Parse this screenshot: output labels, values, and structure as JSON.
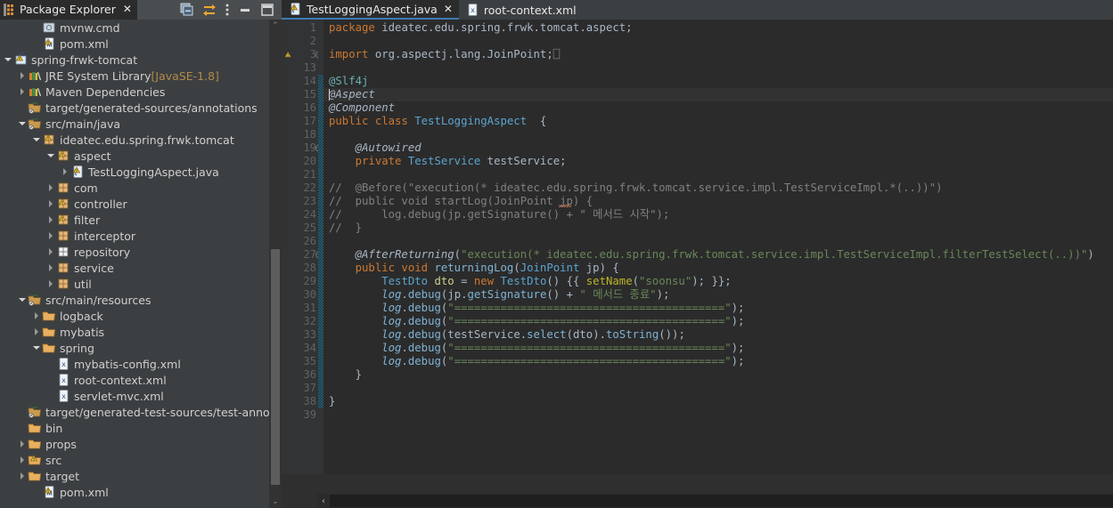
{
  "explorer": {
    "tab": {
      "title": "Package Explorer",
      "close_label": "✕",
      "icon": "package-explorer-icon"
    },
    "toolbar": [
      {
        "name": "collapse-all-icon",
        "tooltip": "Collapse All"
      },
      {
        "name": "link-with-editor-icon",
        "tooltip": "Link with Editor"
      },
      {
        "name": "view-menu-icon",
        "tooltip": "View Menu"
      },
      {
        "name": "minimize-icon",
        "tooltip": "Minimize"
      },
      {
        "name": "maximize-icon",
        "tooltip": "Maximize"
      }
    ],
    "tree": [
      {
        "label": "mvnw.cmd",
        "indent": 2,
        "twisty": "none",
        "icon": "cmd-file-icon"
      },
      {
        "label": "pom.xml",
        "indent": 2,
        "twisty": "none",
        "icon": "maven-pom-icon"
      },
      {
        "label": "spring-frwk-tomcat",
        "indent": 0,
        "twisty": "down",
        "icon": "java-project-icon"
      },
      {
        "label": "JRE System Library",
        "suffix": " [JavaSE-1.8]",
        "indent": 1,
        "twisty": "right",
        "icon": "library-icon"
      },
      {
        "label": "Maven Dependencies",
        "indent": 1,
        "twisty": "right",
        "icon": "library-icon"
      },
      {
        "label": "target/generated-sources/annotations",
        "indent": 1,
        "twisty": "none",
        "icon": "source-folder-icon"
      },
      {
        "label": "src/main/java",
        "indent": 1,
        "twisty": "down",
        "icon": "source-folder-icon"
      },
      {
        "label": "ideatec.edu.spring.frwk.tomcat",
        "indent": 2,
        "twisty": "down",
        "icon": "package-icon"
      },
      {
        "label": "aspect",
        "indent": 3,
        "twisty": "down",
        "icon": "package-icon"
      },
      {
        "label": "TestLoggingAspect.java",
        "indent": 4,
        "twisty": "right",
        "icon": "java-file-icon"
      },
      {
        "label": "com",
        "indent": 3,
        "twisty": "right",
        "icon": "package-plain-icon"
      },
      {
        "label": "controller",
        "indent": 3,
        "twisty": "right",
        "icon": "package-icon"
      },
      {
        "label": "filter",
        "indent": 3,
        "twisty": "right",
        "icon": "package-icon"
      },
      {
        "label": "interceptor",
        "indent": 3,
        "twisty": "right",
        "icon": "package-plain-icon"
      },
      {
        "label": "repository",
        "indent": 3,
        "twisty": "right",
        "icon": "package-empty-icon"
      },
      {
        "label": "service",
        "indent": 3,
        "twisty": "right",
        "icon": "package-plain-icon"
      },
      {
        "label": "util",
        "indent": 3,
        "twisty": "right",
        "icon": "package-plain-icon"
      },
      {
        "label": "src/main/resources",
        "indent": 1,
        "twisty": "down",
        "icon": "source-folder-icon"
      },
      {
        "label": "logback",
        "indent": 2,
        "twisty": "right",
        "icon": "folder-icon"
      },
      {
        "label": "mybatis",
        "indent": 2,
        "twisty": "right",
        "icon": "folder-icon"
      },
      {
        "label": "spring",
        "indent": 2,
        "twisty": "down",
        "icon": "folder-icon"
      },
      {
        "label": "mybatis-config.xml",
        "indent": 3,
        "twisty": "none",
        "icon": "xml-file-icon"
      },
      {
        "label": "root-context.xml",
        "indent": 3,
        "twisty": "none",
        "icon": "xml-file-icon"
      },
      {
        "label": "servlet-mvc.xml",
        "indent": 3,
        "twisty": "none",
        "icon": "xml-file-icon"
      },
      {
        "label": "target/generated-test-sources/test-annotation",
        "indent": 1,
        "twisty": "none",
        "icon": "source-folder-icon"
      },
      {
        "label": "bin",
        "indent": 1,
        "twisty": "none",
        "icon": "folder-icon"
      },
      {
        "label": "props",
        "indent": 1,
        "twisty": "right",
        "icon": "folder-icon"
      },
      {
        "label": "src",
        "indent": 1,
        "twisty": "right",
        "icon": "folder-warn-icon"
      },
      {
        "label": "target",
        "indent": 1,
        "twisty": "right",
        "icon": "folder-icon"
      },
      {
        "label": "pom.xml",
        "indent": 2,
        "twisty": "none",
        "icon": "maven-pom-icon"
      }
    ],
    "scrollbar": {
      "up_arrow": "⌃",
      "down_arrow": "⌄"
    }
  },
  "editor": {
    "tabs": [
      {
        "title": "TestLoggingAspect.java",
        "icon": "java-file-warn-icon",
        "active": true,
        "close_label": "✕"
      },
      {
        "title": "root-context.xml",
        "icon": "xml-file-icon",
        "active": false,
        "close_label": ""
      }
    ],
    "first_line": 1,
    "line_numbers": [
      1,
      2,
      3,
      13,
      14,
      15,
      16,
      17,
      18,
      19,
      20,
      21,
      22,
      23,
      24,
      25,
      26,
      27,
      28,
      29,
      30,
      31,
      32,
      33,
      34,
      35,
      36,
      37,
      38,
      39
    ],
    "current_line": 15,
    "change_bar_from_line": 14,
    "change_bar_to_line": 38,
    "hscroll_left_arrow": "‹",
    "lines": [
      {
        "n": 1,
        "tokens": [
          {
            "t": "package ",
            "c": "kw"
          },
          {
            "t": "ideatec.edu.spring.frwk.tomcat.aspect;",
            "c": "def"
          }
        ]
      },
      {
        "n": 2,
        "tokens": []
      },
      {
        "n": 3,
        "tokens": [
          {
            "t": "import ",
            "c": "kw"
          },
          {
            "t": "org.aspectj.lang.JoinPoint;",
            "c": "def"
          },
          {
            "t": "⎕",
            "c": "cmt"
          }
        ]
      },
      {
        "n": 13,
        "tokens": []
      },
      {
        "n": 14,
        "tokens": [
          {
            "t": "@Slf4j",
            "c": "anT"
          }
        ]
      },
      {
        "n": 15,
        "tokens": [
          {
            "t": "@Aspect",
            "c": "anW"
          }
        ]
      },
      {
        "n": 16,
        "tokens": [
          {
            "t": "@Component",
            "c": "anW"
          }
        ]
      },
      {
        "n": 17,
        "tokens": [
          {
            "t": "public class ",
            "c": "kw"
          },
          {
            "t": "TestLoggingAspect",
            "c": "typ"
          },
          {
            "t": "  {",
            "c": "def"
          }
        ]
      },
      {
        "n": 18,
        "tokens": []
      },
      {
        "n": 19,
        "tokens": [
          {
            "t": "    @Autowired",
            "c": "anW"
          }
        ]
      },
      {
        "n": 20,
        "tokens": [
          {
            "t": "    private ",
            "c": "kw"
          },
          {
            "t": "TestService",
            "c": "typ"
          },
          {
            "t": " testService;",
            "c": "def"
          }
        ]
      },
      {
        "n": 21,
        "tokens": []
      },
      {
        "n": 22,
        "tokens": [
          {
            "t": "//  @Before(\"execution(* ideatec.edu.spring.frwk.tomcat.service.impl.TestServiceImpl.*(..))\")",
            "c": "cmt"
          }
        ]
      },
      {
        "n": 23,
        "tokens": [
          {
            "t": "//  public void startLog(JoinPoint jp) {",
            "c": "cmt"
          }
        ]
      },
      {
        "n": 24,
        "tokens": [
          {
            "t": "//      log.debug(jp.getSignature() + \" 메서드 시작\");",
            "c": "cmt"
          }
        ]
      },
      {
        "n": 25,
        "tokens": [
          {
            "t": "//  }",
            "c": "cmt"
          }
        ]
      },
      {
        "n": 26,
        "tokens": []
      },
      {
        "n": 27,
        "tokens": [
          {
            "t": "    @AfterReturning",
            "c": "anW"
          },
          {
            "t": "(",
            "c": "def"
          },
          {
            "t": "\"execution(* ideatec.edu.spring.frwk.tomcat.service.impl.TestServiceImpl.filterTestSelect(..))\"",
            "c": "str"
          },
          {
            "t": ")",
            "c": "def"
          }
        ]
      },
      {
        "n": 28,
        "tokens": [
          {
            "t": "    public void ",
            "c": "kw"
          },
          {
            "t": "returningLog",
            "c": "mth"
          },
          {
            "t": "(",
            "c": "def"
          },
          {
            "t": "JoinPoint",
            "c": "typ"
          },
          {
            "t": " jp) {",
            "c": "def"
          }
        ]
      },
      {
        "n": 29,
        "tokens": [
          {
            "t": "        ",
            "c": "def"
          },
          {
            "t": "TestDto",
            "c": "typ"
          },
          {
            "t": " ",
            "c": "def"
          },
          {
            "t": "dto",
            "c": "var"
          },
          {
            "t": " = ",
            "c": "def"
          },
          {
            "t": "new ",
            "c": "kw"
          },
          {
            "t": "TestDto",
            "c": "typ"
          },
          {
            "t": "() {{ ",
            "c": "def"
          },
          {
            "t": "setName",
            "c": "ann"
          },
          {
            "t": "(",
            "c": "def"
          },
          {
            "t": "\"soonsu\"",
            "c": "str"
          },
          {
            "t": "); }};",
            "c": "def"
          }
        ]
      },
      {
        "n": 30,
        "tokens": [
          {
            "t": "        ",
            "c": "def"
          },
          {
            "t": "log",
            "c": "stat"
          },
          {
            "t": ".",
            "c": "def"
          },
          {
            "t": "debug",
            "c": "mth"
          },
          {
            "t": "(",
            "c": "def"
          },
          {
            "t": "jp",
            "c": "def"
          },
          {
            "t": ".",
            "c": "def"
          },
          {
            "t": "getSignature",
            "c": "mth"
          },
          {
            "t": "() + ",
            "c": "def"
          },
          {
            "t": "\" 메서드 종료\"",
            "c": "str"
          },
          {
            "t": ");",
            "c": "def"
          }
        ]
      },
      {
        "n": 31,
        "tokens": [
          {
            "t": "        ",
            "c": "def"
          },
          {
            "t": "log",
            "c": "stat"
          },
          {
            "t": ".",
            "c": "def"
          },
          {
            "t": "debug",
            "c": "mth"
          },
          {
            "t": "(",
            "c": "def"
          },
          {
            "t": "\"=========================================\"",
            "c": "str"
          },
          {
            "t": ");",
            "c": "def"
          }
        ]
      },
      {
        "n": 32,
        "tokens": [
          {
            "t": "        ",
            "c": "def"
          },
          {
            "t": "log",
            "c": "stat"
          },
          {
            "t": ".",
            "c": "def"
          },
          {
            "t": "debug",
            "c": "mth"
          },
          {
            "t": "(",
            "c": "def"
          },
          {
            "t": "\"=========================================\"",
            "c": "str"
          },
          {
            "t": ");",
            "c": "def"
          }
        ]
      },
      {
        "n": 33,
        "tokens": [
          {
            "t": "        ",
            "c": "def"
          },
          {
            "t": "log",
            "c": "stat"
          },
          {
            "t": ".",
            "c": "def"
          },
          {
            "t": "debug",
            "c": "mth"
          },
          {
            "t": "(",
            "c": "def"
          },
          {
            "t": "testService",
            "c": "def"
          },
          {
            "t": ".",
            "c": "def"
          },
          {
            "t": "select",
            "c": "mth"
          },
          {
            "t": "(",
            "c": "def"
          },
          {
            "t": "dto",
            "c": "def"
          },
          {
            "t": ").",
            "c": "def"
          },
          {
            "t": "toString",
            "c": "mth"
          },
          {
            "t": "());",
            "c": "def"
          }
        ]
      },
      {
        "n": 34,
        "tokens": [
          {
            "t": "        ",
            "c": "def"
          },
          {
            "t": "log",
            "c": "stat"
          },
          {
            "t": ".",
            "c": "def"
          },
          {
            "t": "debug",
            "c": "mth"
          },
          {
            "t": "(",
            "c": "def"
          },
          {
            "t": "\"=========================================\"",
            "c": "str"
          },
          {
            "t": ");",
            "c": "def"
          }
        ]
      },
      {
        "n": 35,
        "tokens": [
          {
            "t": "        ",
            "c": "def"
          },
          {
            "t": "log",
            "c": "stat"
          },
          {
            "t": ".",
            "c": "def"
          },
          {
            "t": "debug",
            "c": "mth"
          },
          {
            "t": "(",
            "c": "def"
          },
          {
            "t": "\"=========================================\"",
            "c": "str"
          },
          {
            "t": ");",
            "c": "def"
          }
        ]
      },
      {
        "n": 36,
        "tokens": [
          {
            "t": "    }",
            "c": "def"
          }
        ]
      },
      {
        "n": 37,
        "tokens": []
      },
      {
        "n": 38,
        "tokens": [
          {
            "t": "}",
            "c": "def"
          }
        ]
      },
      {
        "n": 39,
        "tokens": []
      }
    ]
  },
  "colors": {
    "editor_bg": "#2b2b2b",
    "panel_bg": "#3c3f41",
    "gutter_bg": "#313335",
    "accent_tab": "#3d7ab5",
    "keyword": "#cc7832",
    "string": "#6a8759",
    "comment": "#808080",
    "type": "#5ba4cf",
    "annotation": "#bbb529",
    "change_bar": "#1d6e8c"
  }
}
